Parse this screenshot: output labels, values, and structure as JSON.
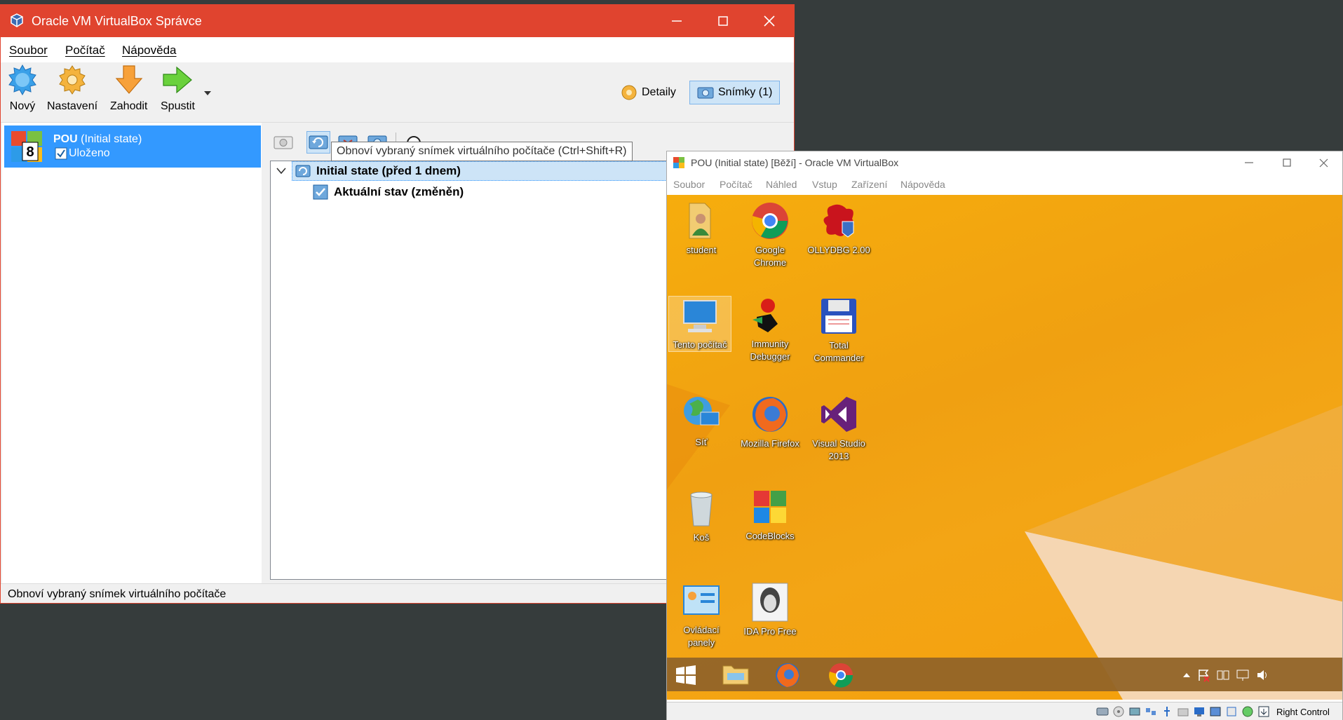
{
  "manager": {
    "title": "Oracle VM VirtualBox Správce",
    "menu": [
      "Soubor",
      "Počítač",
      "Nápověda"
    ],
    "toolbar": {
      "new": "Nový",
      "settings": "Nastavení",
      "discard": "Zahodit",
      "start": "Spustit",
      "details": "Detaily",
      "snapshots": "Snímky (1)"
    },
    "vm": {
      "name": "POU",
      "state_note": "(Initial state)",
      "status": "Uloženo"
    },
    "tooltip": "Obnoví vybraný snímek virtuálního počítače (Ctrl+Shift+R)",
    "tree": {
      "snapshot": "Initial state (před 1 dnem)",
      "current": "Aktuální stav (změněn)"
    },
    "statusbar": "Obnoví vybraný snímek virtuálního počítače"
  },
  "guest": {
    "title": "POU (Initial state) [Běží] - Oracle VM VirtualBox",
    "menu": [
      "Soubor",
      "Počítač",
      "Náhled",
      "Vstup",
      "Zařízení",
      "Nápověda"
    ],
    "icons": [
      {
        "label": "student"
      },
      {
        "label": "Google Chrome"
      },
      {
        "label": "OLLYDBG 2.00"
      },
      {
        "label": "Tento počítač"
      },
      {
        "label": "Immunity Debugger"
      },
      {
        "label": "Total Commander"
      },
      {
        "label": "Síť"
      },
      {
        "label": "Mozilla Firefox"
      },
      {
        "label": "Visual Studio 2013"
      },
      {
        "label": "Koš"
      },
      {
        "label": "CodeBlocks"
      },
      {
        "label": "Ovládací panely"
      },
      {
        "label": "IDA Pro Free"
      }
    ],
    "host_key": "Right Control"
  }
}
